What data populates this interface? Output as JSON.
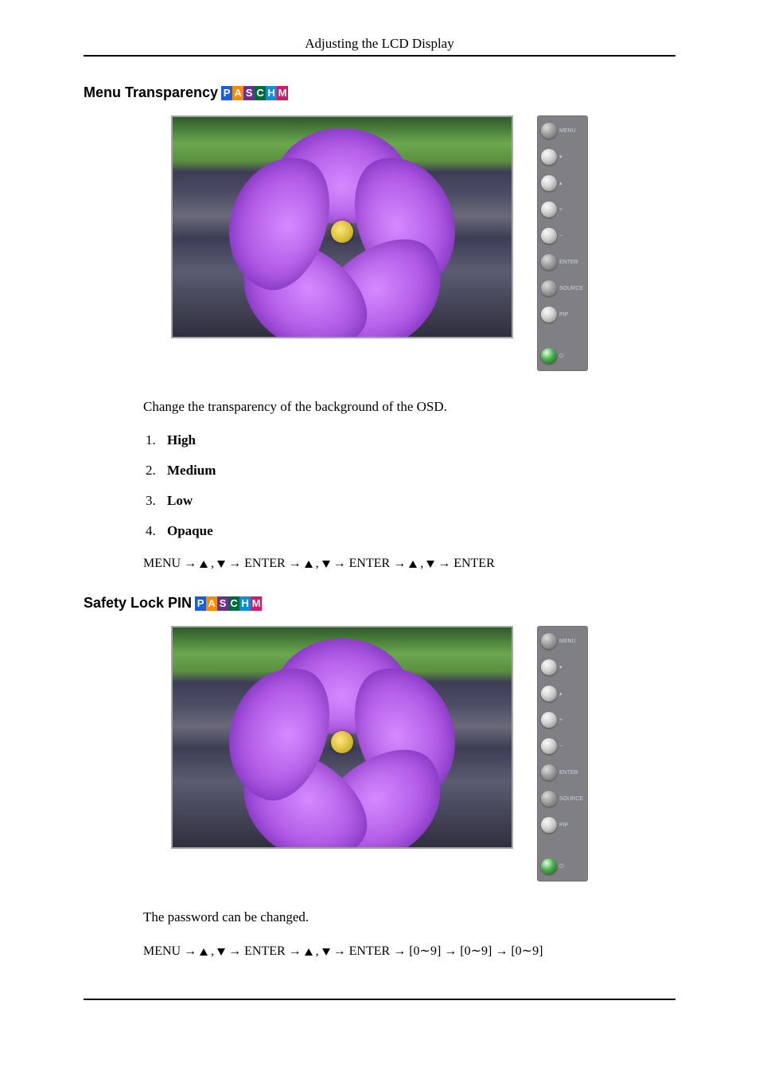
{
  "running_head": "Adjusting the LCD Display",
  "badge_letters": {
    "p": "P",
    "a": "A",
    "s": "S",
    "c": "C",
    "h": "H",
    "m": "M"
  },
  "panel": {
    "menu": "MENU",
    "enter": "ENTER",
    "source": "SOURCE",
    "pip": "PIP"
  },
  "section1": {
    "title": "Menu Transparency",
    "desc": "Change the transparency of the background of the OSD.",
    "items": [
      "High",
      "Medium",
      "Low",
      "Opaque"
    ],
    "nav_menu": "MENU",
    "nav_enter": "ENTER"
  },
  "section2": {
    "title": "Safety Lock PIN",
    "desc": "The password can be changed.",
    "nav_menu": "MENU",
    "nav_enter": "ENTER",
    "nav_digits": "[0∼9]"
  }
}
